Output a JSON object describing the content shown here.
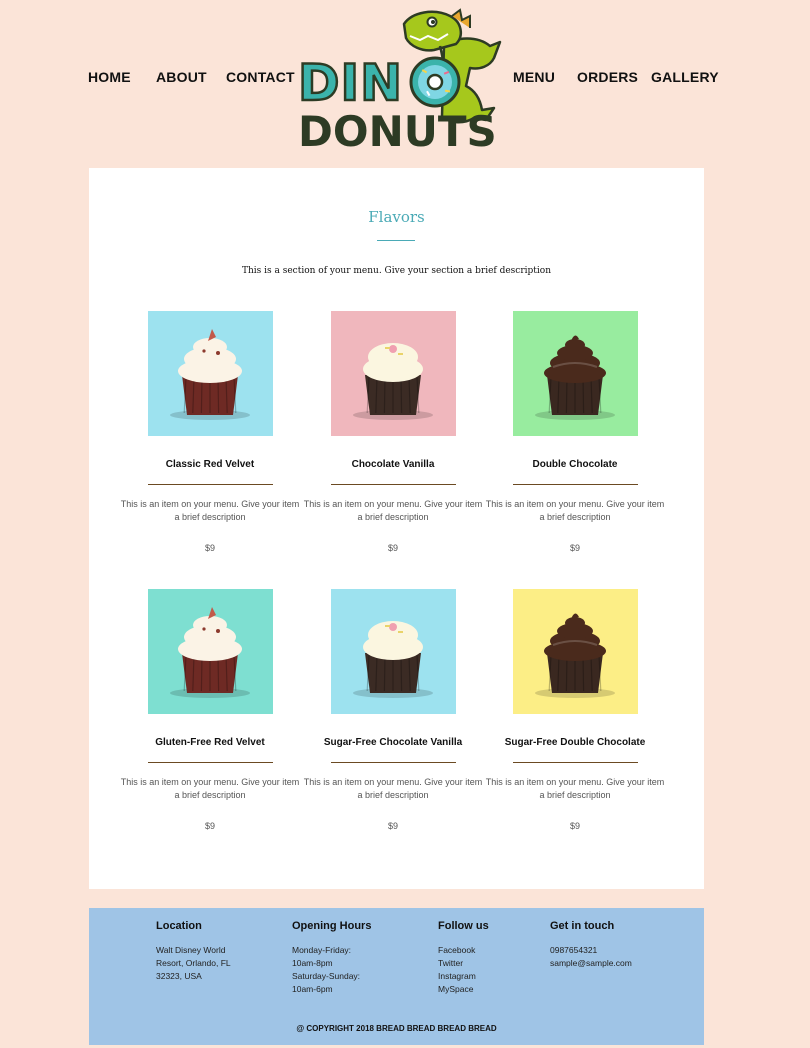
{
  "nav": {
    "home": "HOME",
    "about": "ABOUT",
    "contact": "CONTACT",
    "menu": "MENU",
    "orders": "ORDERS",
    "gallery": "GALLERY"
  },
  "logo": {
    "line1": "DINO",
    "line2": "DONUTS",
    "colors": {
      "teal": "#3bb3ab",
      "dark": "#2d3b24",
      "dino": "#a6c81c"
    }
  },
  "section": {
    "title": "Flavors",
    "description": "This is a section of your menu. Give your section a brief description"
  },
  "items": [
    {
      "name": "Classic Red Velvet",
      "description": "This is an item on your menu. Give your item a brief description",
      "price": "$9",
      "bg": "#9de2ef",
      "cake": "#6e2a24",
      "frosting": "#fbf3e6",
      "topping": "crumbs"
    },
    {
      "name": "Chocolate Vanilla",
      "description": "This is an item on your menu. Give your item a brief description",
      "price": "$9",
      "bg": "#f0b7bd",
      "cake": "#3b2b24",
      "frosting": "#fbf6e0",
      "topping": "sprinkles"
    },
    {
      "name": "Double Chocolate",
      "description": "This is an item on your menu. Give your item a brief description",
      "price": "$9",
      "bg": "#98ec9f",
      "cake": "#3a2820",
      "frosting": "#4a2a1c",
      "topping": "swirl"
    },
    {
      "name": "Gluten-Free Red Velvet",
      "description": "This is an item on your menu. Give your item a brief description",
      "price": "$9",
      "bg": "#7edfd1",
      "cake": "#6e2a24",
      "frosting": "#fbf3e6",
      "topping": "crumbs"
    },
    {
      "name": "Sugar-Free Chocolate Vanilla",
      "description": "This is an item on your menu. Give your item a brief description",
      "price": "$9",
      "bg": "#9de2ef",
      "cake": "#3b2b24",
      "frosting": "#fbf6e0",
      "topping": "sprinkles"
    },
    {
      "name": "Sugar-Free Double Chocolate",
      "description": "This is an item on your menu. Give your item a brief description",
      "price": "$9",
      "bg": "#fcee86",
      "cake": "#3a2820",
      "frosting": "#4a2a1c",
      "topping": "swirl"
    }
  ],
  "footer": {
    "location": {
      "heading": "Location",
      "address": "Walt Disney World\nResort, Orlando, FL\n32323, USA"
    },
    "hours": {
      "heading": "Opening Hours",
      "text": "Monday-Friday:\n10am-8pm\nSaturday-Sunday:\n10am-6pm"
    },
    "follow": {
      "heading": "Follow us",
      "links": [
        "Facebook",
        "Twitter",
        "Instagram",
        "MySpace"
      ]
    },
    "contact": {
      "heading": "Get in touch",
      "phone": "0987654321",
      "email": "sample@sample.com"
    },
    "copyright": "@ COPYRIGHT 2018 BREAD BREAD BREAD BREAD"
  },
  "colors": {
    "page_bg": "#fbe4d8",
    "card_bg": "#ffffff",
    "accent": "#4aaab6",
    "footer_bg": "#9fc4e6",
    "item_rule": "#6b4a22"
  }
}
